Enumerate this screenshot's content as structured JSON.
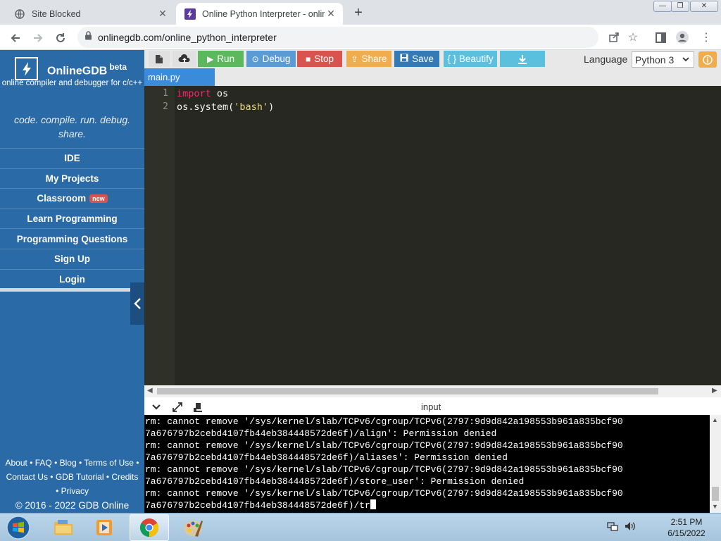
{
  "browser": {
    "tabs": [
      {
        "title": "Site Blocked",
        "active": false
      },
      {
        "title": "Online Python Interpreter - online",
        "active": true
      }
    ],
    "url": "onlinegdb.com/online_python_interpreter",
    "new_tab": "+"
  },
  "sidebar": {
    "brand": "OnlineGDB",
    "beta": "beta",
    "subtitle": "online compiler and debugger for c/c++",
    "tagline": "code. compile. run. debug. share.",
    "menu": [
      {
        "label": "IDE"
      },
      {
        "label": "My Projects"
      },
      {
        "label": "Classroom",
        "badge": "new"
      },
      {
        "label": "Learn Programming"
      },
      {
        "label": "Programming Questions"
      },
      {
        "label": "Sign Up"
      },
      {
        "label": "Login"
      }
    ],
    "footer": {
      "line1": "About • FAQ • Blog • Terms of Use •",
      "line2": "Contact Us • GDB Tutorial • Credits",
      "line3": "• Privacy",
      "copyright": "© 2016 - 2022 GDB Online"
    }
  },
  "ide": {
    "buttons": {
      "run": "Run",
      "debug": "Debug",
      "stop": "Stop",
      "share": "Share",
      "save": "Save",
      "beautify": "{ } Beautify"
    },
    "colors": {
      "run": "#5cb85c",
      "debug": "#5b9bd5",
      "stop": "#d9534f",
      "share": "#f0ad4e",
      "save": "#337ab7",
      "beautify": "#5bc0de",
      "download": "#5bc0de"
    },
    "language_label": "Language",
    "language_value": "Python 3",
    "file_tab": "main.py",
    "code_lines": [
      {
        "num": "1",
        "kw": "import",
        "rest": " os"
      },
      {
        "num": "2",
        "pre": "os.system(",
        "str": "'bash'",
        "post": ")"
      }
    ],
    "io_label": "input",
    "terminal_lines": [
      "rm: cannot remove '/sys/kernel/slab/TCPv6/cgroup/TCPv6(2797:9d9d842a198553b961a835bcf90",
      "7a676797b2cebd4107fb44eb384448572de6f)/align': Permission denied",
      "rm: cannot remove '/sys/kernel/slab/TCPv6/cgroup/TCPv6(2797:9d9d842a198553b961a835bcf90",
      "7a676797b2cebd4107fb44eb384448572de6f)/aliases': Permission denied",
      "rm: cannot remove '/sys/kernel/slab/TCPv6/cgroup/TCPv6(2797:9d9d842a198553b961a835bcf90",
      "7a676797b2cebd4107fb44eb384448572de6f)/store_user': Permission denied",
      "rm: cannot remove '/sys/kernel/slab/TCPv6/cgroup/TCPv6(2797:9d9d842a198553b961a835bcf90",
      "7a676797b2cebd4107fb44eb384448572de6f)/tr"
    ]
  },
  "taskbar": {
    "time": "2:51 PM",
    "date": "6/15/2022"
  }
}
